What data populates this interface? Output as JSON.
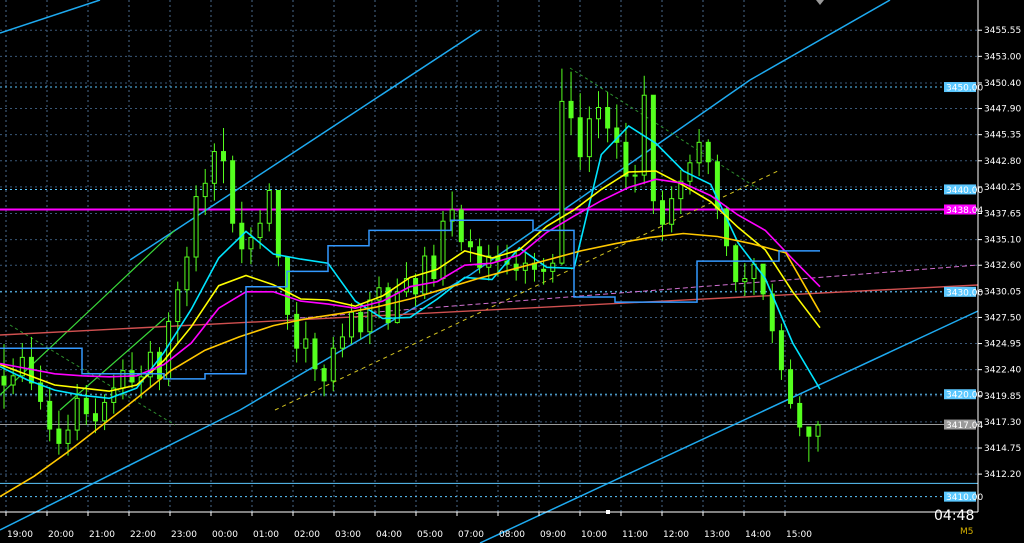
{
  "chart_data": {
    "type": "candlestick",
    "title": "",
    "xlabel": "",
    "ylabel": "",
    "timeframe": "M5",
    "countdown": "04:48",
    "ylim": [
      3408.5,
      3458.5
    ],
    "grid": true,
    "x_tick_labels": [
      "19:00",
      "20:00",
      "21:00",
      "22:00",
      "23:00",
      "00:00",
      "01:00",
      "02:00",
      "03:00",
      "04:00",
      "05:00",
      "07:00",
      "08:00",
      "09:00",
      "10:00",
      "11:00",
      "12:00",
      "13:00",
      "14:00",
      "15:00"
    ],
    "y_ticks": [
      3455.55,
      3453.0,
      3450.4,
      3447.9,
      3445.35,
      3442.8,
      3440.25,
      3437.65,
      3435.1,
      3432.6,
      3430.05,
      3427.5,
      3424.95,
      3422.4,
      3419.85,
      3417.3,
      3414.75,
      3412.2
    ],
    "y_tick_labels": [
      "3455.55",
      "3453.00",
      "3450.40",
      "3447.90",
      "3445.35",
      "3442.80",
      "3440.25",
      "3437.65",
      "3435.10",
      "3432.60",
      "3430.05",
      "3427.50",
      "3424.95",
      "3422.40",
      "3419.85",
      "3417.30",
      "3414.75",
      "3412.20"
    ],
    "horizontal_levels": [
      {
        "price": 3450.0,
        "label": "3450.00",
        "color": "#5bc8ff",
        "style": "dashed"
      },
      {
        "price": 3440.0,
        "label": "3440.00",
        "color": "#5bc8ff",
        "style": "dashed"
      },
      {
        "price": 3438.04,
        "label": "3438.04",
        "color": "#ff00ff",
        "style": "solid"
      },
      {
        "price": 3430.0,
        "label": "3430.00",
        "color": "#5bc8ff",
        "style": "dashed"
      },
      {
        "price": 3420.0,
        "label": "3420.00",
        "color": "#5bc8ff",
        "style": "dashed"
      },
      {
        "price": 3417.04,
        "label": "3417.04",
        "color": "#9a9a9a",
        "style": "solid"
      },
      {
        "price": 3411.3,
        "label": "",
        "color": "#5bc8ff",
        "style": "solid"
      },
      {
        "price": 3410.0,
        "label": "3410.00",
        "color": "#5bc8ff",
        "style": "dashed"
      }
    ],
    "candles_hlc": [
      [
        3424.9,
        3418.6,
        3420.9
      ],
      [
        3423.5,
        3420.0,
        3421.8
      ],
      [
        3425.0,
        3421.2,
        3423.6
      ],
      [
        3425.6,
        3420.4,
        3421.1
      ],
      [
        3422.8,
        3418.5,
        3419.3
      ],
      [
        3420.7,
        3415.4,
        3416.6
      ],
      [
        3418.4,
        3414.1,
        3415.2
      ],
      [
        3418.0,
        3414.0,
        3416.5
      ],
      [
        3421.0,
        3415.5,
        3419.6
      ],
      [
        3420.9,
        3417.0,
        3418.1
      ],
      [
        3419.6,
        3416.2,
        3417.4
      ],
      [
        3420.0,
        3416.5,
        3419.2
      ],
      [
        3421.9,
        3418.1,
        3420.6
      ],
      [
        3423.4,
        3419.5,
        3422.3
      ],
      [
        3424.1,
        3420.6,
        3421.2
      ],
      [
        3422.8,
        3419.6,
        3421.7
      ],
      [
        3425.2,
        3420.6,
        3424.1
      ],
      [
        3424.6,
        3420.4,
        3421.5
      ],
      [
        3428.0,
        3420.8,
        3427.1
      ],
      [
        3431.0,
        3424.9,
        3430.2
      ],
      [
        3434.4,
        3428.6,
        3433.4
      ],
      [
        3440.4,
        3432.0,
        3439.3
      ],
      [
        3442.0,
        3437.5,
        3440.6
      ],
      [
        3444.5,
        3438.9,
        3443.7
      ],
      [
        3446.0,
        3440.6,
        3442.8
      ],
      [
        3443.3,
        3435.8,
        3436.7
      ],
      [
        3438.8,
        3432.8,
        3434.2
      ],
      [
        3436.3,
        3432.7,
        3435.3
      ],
      [
        3438.0,
        3434.2,
        3436.7
      ],
      [
        3440.6,
        3435.9,
        3439.9
      ],
      [
        3438.8,
        3432.5,
        3433.4
      ],
      [
        3432.6,
        3426.3,
        3427.8
      ],
      [
        3429.0,
        3423.1,
        3424.5
      ],
      [
        3427.1,
        3423.1,
        3425.4
      ],
      [
        3426.0,
        3421.3,
        3422.5
      ],
      [
        3422.9,
        3419.8,
        3421.3
      ],
      [
        3425.6,
        3420.3,
        3424.5
      ],
      [
        3426.9,
        3423.6,
        3425.6
      ],
      [
        3428.9,
        3424.9,
        3428.0
      ],
      [
        3428.8,
        3425.4,
        3426.1
      ],
      [
        3430.0,
        3424.9,
        3429.2
      ],
      [
        3431.5,
        3427.4,
        3430.4
      ],
      [
        3430.9,
        3426.3,
        3427.0
      ],
      [
        3431.3,
        3426.9,
        3430.0
      ],
      [
        3432.9,
        3429.5,
        3431.3
      ],
      [
        3431.8,
        3428.6,
        3429.8
      ],
      [
        3434.4,
        3429.3,
        3433.5
      ],
      [
        3434.6,
        3430.5,
        3431.3
      ],
      [
        3437.9,
        3430.6,
        3436.9
      ],
      [
        3439.8,
        3435.4,
        3438.0
      ],
      [
        3438.5,
        3434.0,
        3434.9
      ],
      [
        3436.1,
        3432.9,
        3434.4
      ],
      [
        3435.2,
        3431.8,
        3432.4
      ],
      [
        3434.6,
        3431.1,
        3433.5
      ],
      [
        3434.5,
        3431.5,
        3433.0
      ],
      [
        3434.6,
        3431.7,
        3432.7
      ],
      [
        3434.0,
        3431.1,
        3432.1
      ],
      [
        3433.9,
        3430.8,
        3432.8
      ],
      [
        3433.8,
        3431.0,
        3432.2
      ],
      [
        3433.3,
        3430.7,
        3432.0
      ],
      [
        3433.7,
        3430.9,
        3432.8
      ],
      [
        3451.8,
        3432.6,
        3448.6
      ],
      [
        3451.5,
        3445.3,
        3447.0
      ],
      [
        3449.4,
        3441.9,
        3443.2
      ],
      [
        3448.1,
        3441.7,
        3446.9
      ],
      [
        3449.6,
        3445.0,
        3448.0
      ],
      [
        3449.5,
        3444.6,
        3446.0
      ],
      [
        3448.3,
        3443.0,
        3444.6
      ],
      [
        3446.5,
        3440.1,
        3441.3
      ],
      [
        3442.4,
        3439.7,
        3441.4
      ],
      [
        3451.1,
        3440.5,
        3449.2
      ],
      [
        3449.2,
        3437.6,
        3438.9
      ],
      [
        3439.9,
        3435.0,
        3436.6
      ],
      [
        3440.3,
        3435.8,
        3439.1
      ],
      [
        3441.9,
        3437.6,
        3440.8
      ],
      [
        3443.4,
        3439.5,
        3442.6
      ],
      [
        3445.9,
        3441.3,
        3444.6
      ],
      [
        3444.9,
        3441.5,
        3442.7
      ],
      [
        3443.4,
        3437.1,
        3438.1
      ],
      [
        3438.4,
        3433.5,
        3434.5
      ],
      [
        3434.7,
        3430.1,
        3431.0
      ],
      [
        3432.8,
        3429.6,
        3431.3
      ],
      [
        3433.3,
        3429.7,
        3432.7
      ],
      [
        3432.3,
        3429.2,
        3429.8
      ],
      [
        3430.8,
        3425.0,
        3426.2
      ],
      [
        3426.9,
        3421.4,
        3422.4
      ],
      [
        3423.4,
        3418.6,
        3419.1
      ],
      [
        3419.8,
        3415.9,
        3416.8
      ],
      [
        3416.8,
        3413.4,
        3415.9
      ],
      [
        3417.4,
        3414.4,
        3417.0
      ]
    ],
    "series": [
      {
        "color": "#00e5ff",
        "values": [
          3422.7,
          3421.4,
          3420.4,
          3419.9,
          3419.6,
          3420.6,
          3424.1,
          3428.3,
          3433.3,
          3435.9,
          3433.7,
          3433.2,
          3432.8,
          3429.1,
          3427.4,
          3427.5,
          3429.3,
          3431.4,
          3431.2,
          3434.3,
          3432.4,
          3432.3,
          3443.4,
          3446.2,
          3444.5,
          3441.8,
          3440.5,
          3434.8,
          3431.3,
          3425.0,
          3420.5
        ]
      },
      {
        "color": "#ffff00",
        "values": [
          3422.9,
          3421.9,
          3420.9,
          3420.6,
          3420.3,
          3420.9,
          3423.3,
          3426.6,
          3430.6,
          3431.6,
          3430.7,
          3429.3,
          3429.2,
          3428.6,
          3429.6,
          3431.4,
          3432.2,
          3434.0,
          3433.3,
          3434.1,
          3436.4,
          3438.0,
          3440.0,
          3441.7,
          3441.8,
          3440.4,
          3438.8,
          3436.3,
          3434.1,
          3430.0,
          3426.5
        ]
      },
      {
        "color": "#ff00ff",
        "values": [
          3423.0,
          3422.5,
          3422.0,
          3421.8,
          3421.7,
          3421.8,
          3422.9,
          3425.0,
          3428.4,
          3430.0,
          3430.0,
          3429.1,
          3428.8,
          3428.4,
          3429.1,
          3430.5,
          3431.0,
          3432.6,
          3432.8,
          3433.6,
          3435.8,
          3437.4,
          3438.9,
          3440.2,
          3441.0,
          3440.6,
          3439.4,
          3437.5,
          3436.0,
          3433.2,
          3430.5
        ]
      },
      {
        "color": "#ffc800",
        "values": [
          3410.0,
          3412.0,
          3414.4,
          3417.0,
          3419.6,
          3422.3,
          3424.3,
          3425.6,
          3426.7,
          3427.4,
          3427.9,
          3428.5,
          3429.3,
          3430.3,
          3431.3,
          3432.2,
          3433.1,
          3434.0,
          3434.7,
          3435.3,
          3435.7,
          3435.4,
          3434.7,
          3433.8,
          3428.0
        ]
      },
      {
        "color": "#3399ff",
        "values": [
          3424.5,
          3424.5,
          3422.0,
          3422.0,
          3421.5,
          3422.0,
          3430.5,
          3432.0,
          3434.5,
          3436.0,
          3436.0,
          3437.0,
          3437.0,
          3436.0,
          3429.5,
          3429.0,
          3429.0,
          3433.0,
          3433.0,
          3434.0,
          3434.0
        ]
      },
      {
        "color": "#d05050",
        "values": [
          3428.0,
          3431.0
        ]
      },
      {
        "color": "#d070d0",
        "values": [
          3429.0,
          3433.0
        ]
      }
    ]
  }
}
